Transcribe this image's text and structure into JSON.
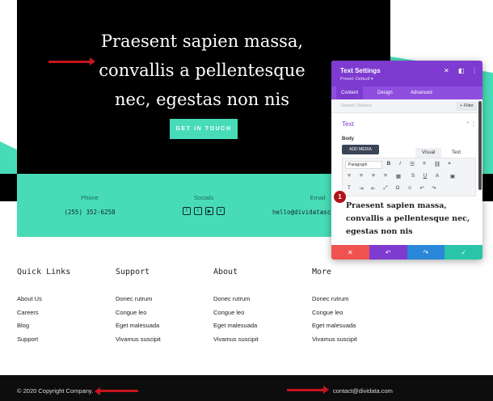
{
  "hero": {
    "title": "Praesent sapien massa, convallis a pellentesque nec, egestas non nis",
    "cta": "GET IN TOUCH"
  },
  "contact": {
    "phone_label": "Phone",
    "phone_value": "(255) 352-6258",
    "socials_label": "Socials",
    "email_label": "Email",
    "email_value": "hello@dividatasc"
  },
  "footer": {
    "columns": [
      {
        "title": "Quick Links",
        "links": [
          "About Us",
          "Careers",
          "Blog",
          "Support"
        ]
      },
      {
        "title": "Support",
        "links": [
          "Donec rutrum",
          "Congue leo",
          "Eget malesuada",
          "Vivamus suscipit"
        ]
      },
      {
        "title": "About",
        "links": [
          "Donec rutrum",
          "Congue leo",
          "Eget malesuada",
          "Vivamus suscipit"
        ]
      },
      {
        "title": "More",
        "links": [
          "Donec rutrum",
          "Congue leo",
          "Eget malesuada",
          "Vivamus suscipit"
        ]
      }
    ],
    "copyright": "© 2020 Copyright Company.",
    "email": "contact@dividata.com"
  },
  "panel": {
    "title": "Text Settings",
    "preset": "Preset: Default ▾",
    "tabs": [
      "Content",
      "Design",
      "Advanced"
    ],
    "search_placeholder": "Search Options",
    "filter": "+ Filter",
    "section": "Text",
    "body_label": "Body",
    "add_media": "ADD MEDIA",
    "mode_visual": "Visual",
    "mode_text": "Text",
    "paragraph": "Paragraph",
    "editor_text": "Praesent sapien massa, convallis a pellentesque nec, egestas non nis",
    "badge": "1"
  },
  "colors": {
    "accent_teal": "#47dcb7",
    "panel_purple": "#7e3bd0",
    "cancel_red": "#ef5350",
    "undo_purple": "#7e3bd0",
    "redo_blue": "#2b87da",
    "save_green": "#29c4a9"
  }
}
